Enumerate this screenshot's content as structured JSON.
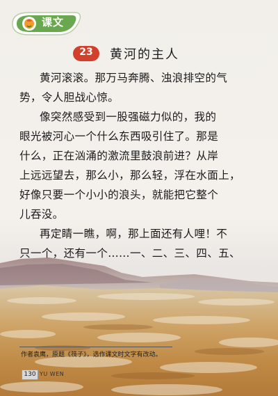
{
  "header": {
    "badge_label": "课文",
    "lesson_number": "23",
    "title": "黄河的主人"
  },
  "body_lines": [
    "黄河滚滚。那万马奔腾、浊浪排空的气",
    "势，令人胆战心惊。",
    "像突然感受到一股强磁力似的，我的",
    "眼光被河心一个什么东西吸引住了。那是",
    "什么，正在汹涌的激流里鼓浪前进？从岸",
    "上远远望去，那么小，那么轻，浮在水面上，",
    "好像只要一个小小的浪头，就能把它整个",
    "儿吞没。",
    "再定睛一瞧，啊，那上面还有人哩！不",
    "只一个，还有一个……一、二、三、四、五、"
  ],
  "footnote": "作者袁鹰，原题《筏子》，选作课文时文字有改动。",
  "footer": {
    "page_number": "130",
    "subject": "YU WEN"
  },
  "colors": {
    "badge_green": "#6aa84f",
    "lesson_red": "#d0402a",
    "river_ochre": "#c99a55"
  }
}
